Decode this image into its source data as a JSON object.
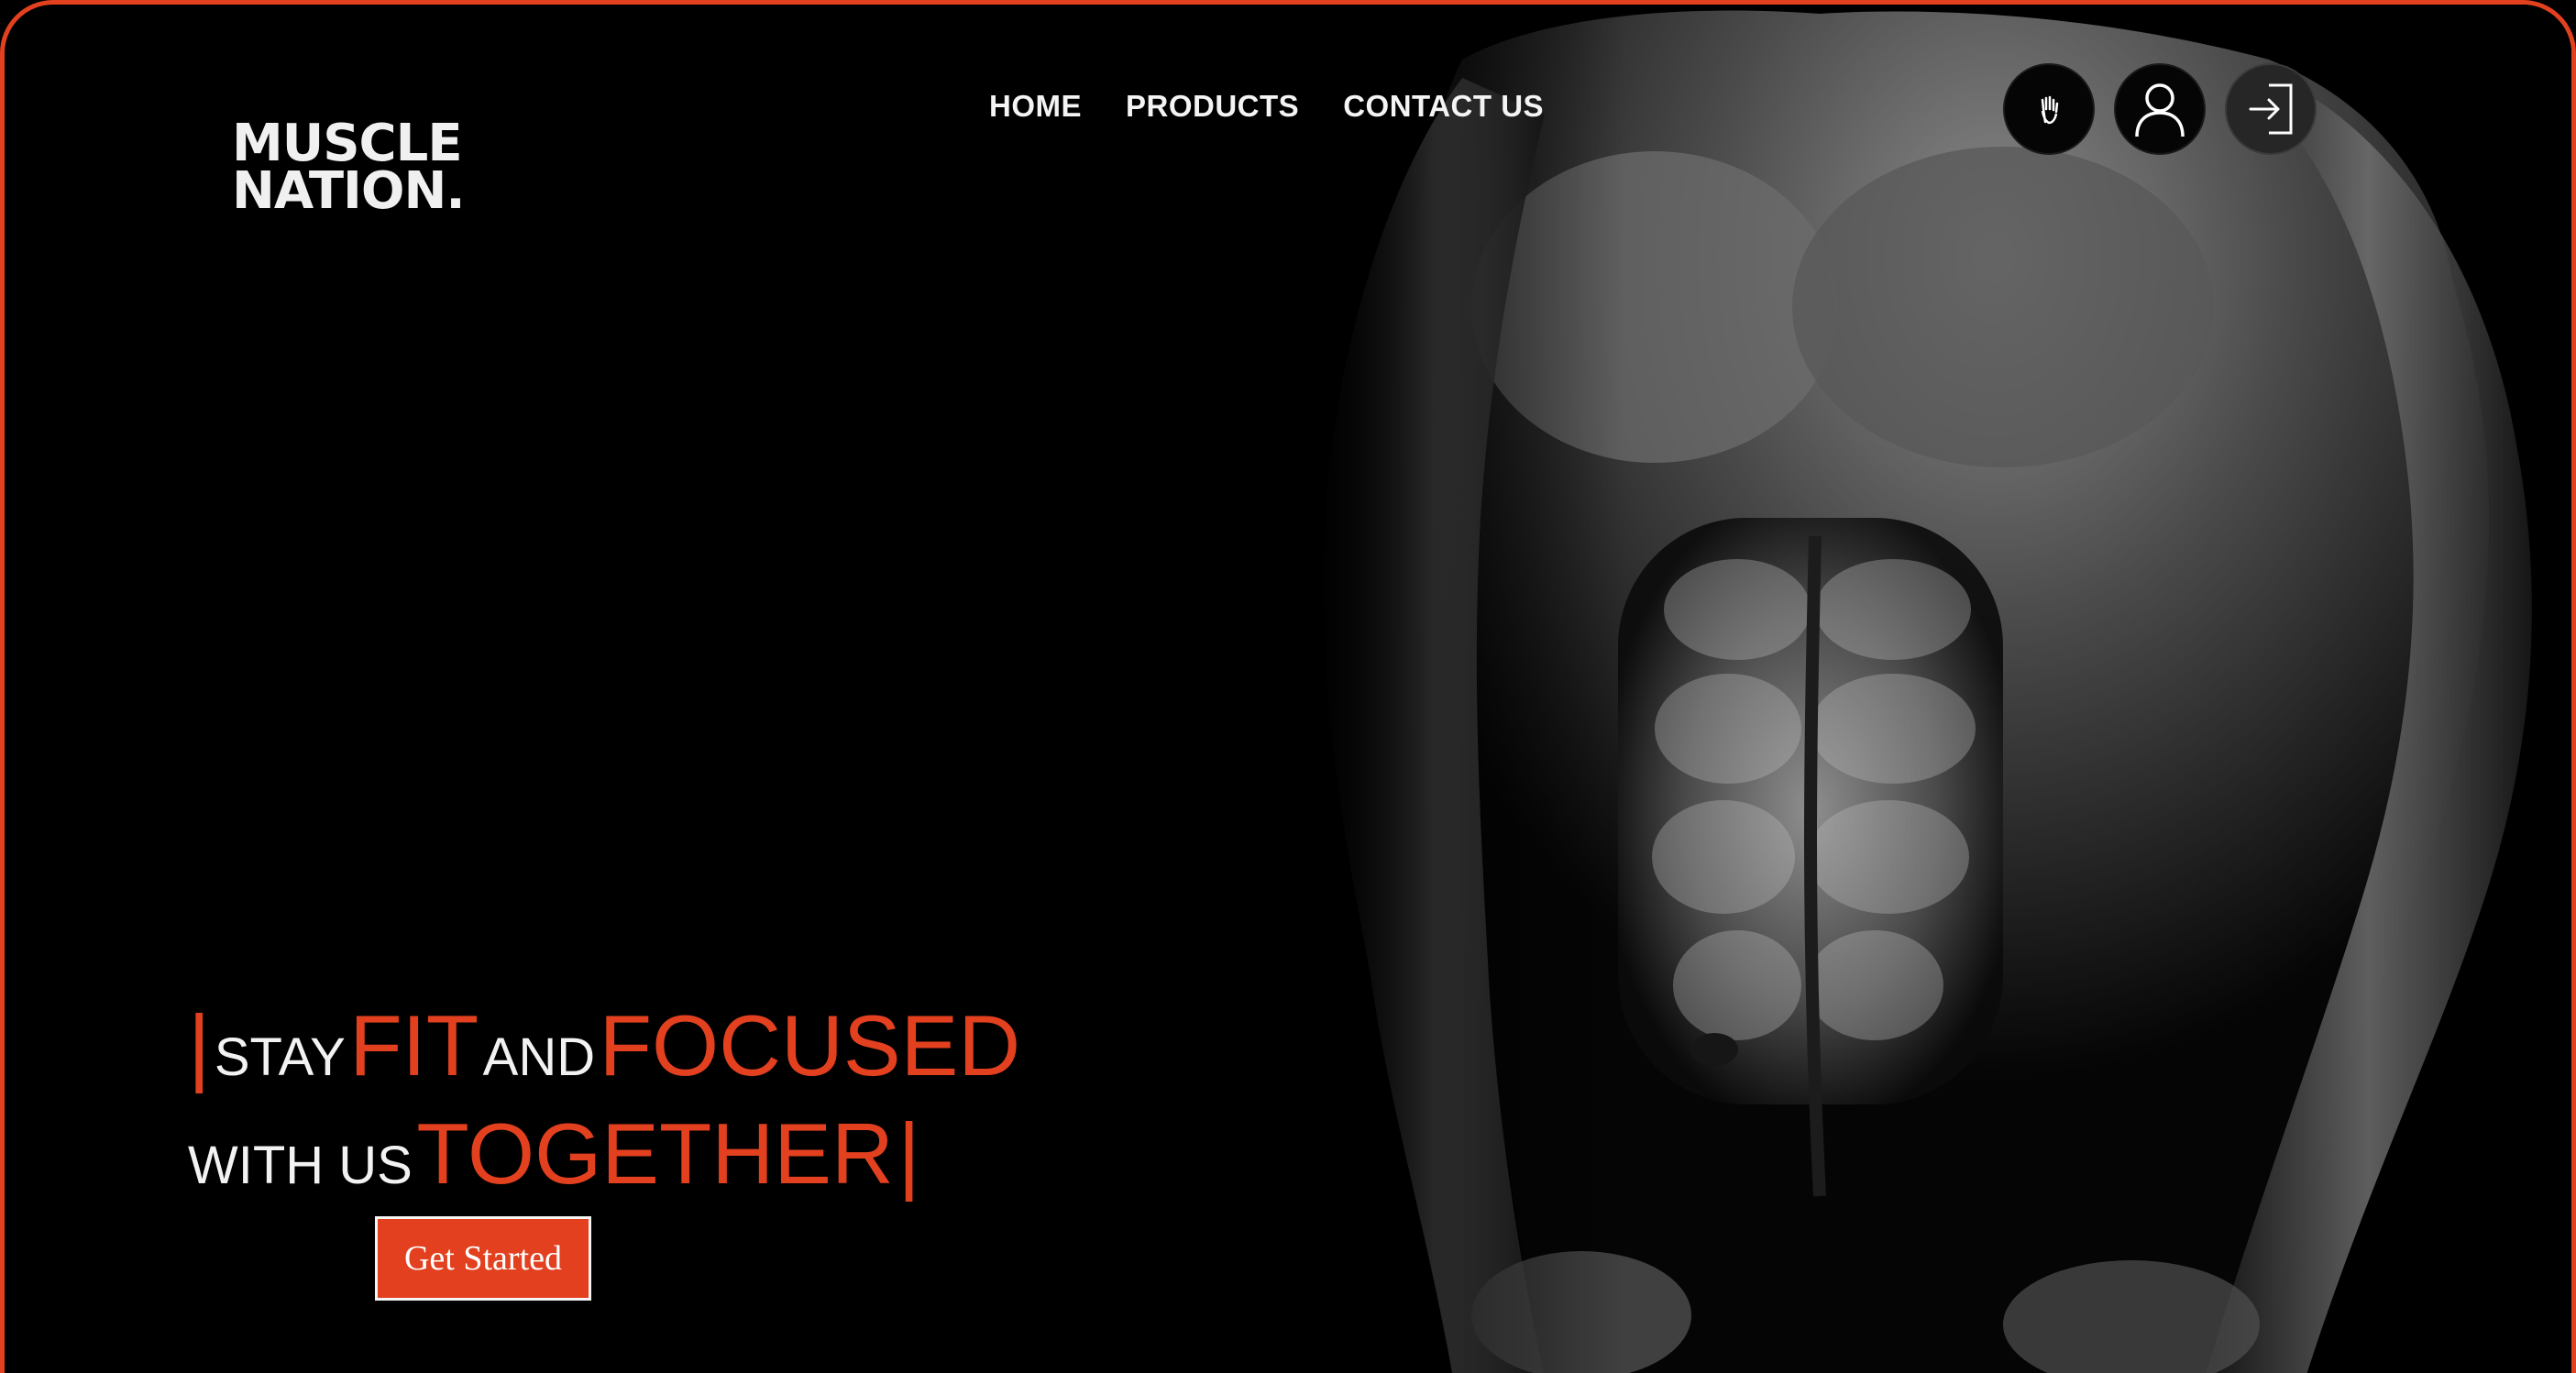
{
  "brand": {
    "line1": "MUSCLE",
    "line2": "NATION."
  },
  "nav": {
    "items": [
      "HOME",
      "PRODUCTS",
      "CONTACT US"
    ]
  },
  "header_icons": [
    "hand-icon",
    "user-icon",
    "login-icon"
  ],
  "hero": {
    "bar_left": "|",
    "word1": "STAY",
    "word2": "FIT",
    "word3": "AND",
    "word4": "FOCUSED",
    "word5": "WITH US",
    "word6": "TOGETHER",
    "bar_right": "|",
    "cta_label": "Get Started"
  },
  "colors": {
    "accent": "#e2401f",
    "background": "#000000",
    "text": "#f2f2f2"
  }
}
